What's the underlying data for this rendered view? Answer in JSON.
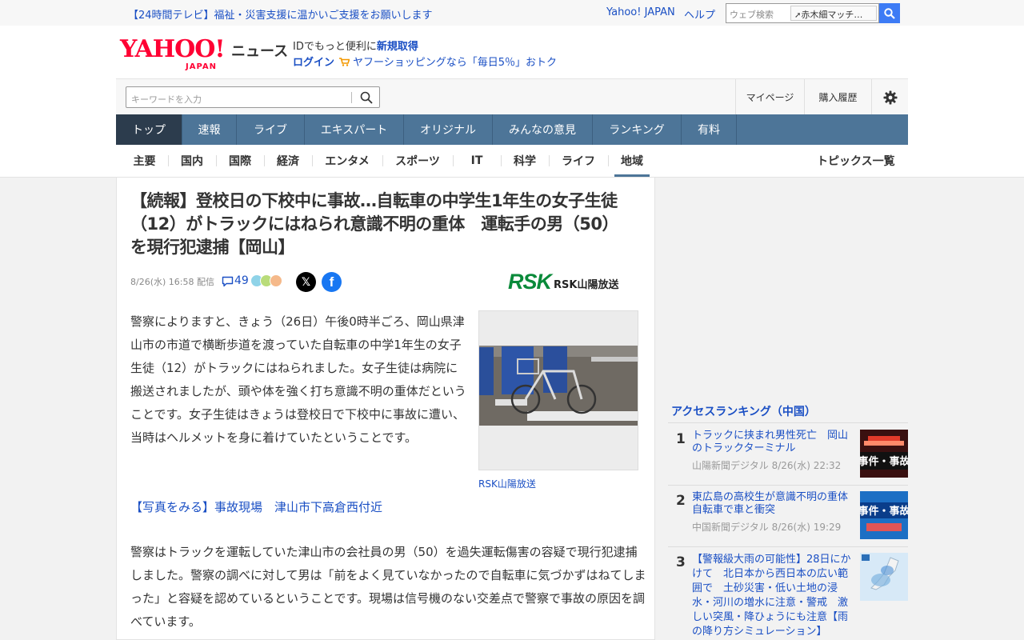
{
  "topbar": {
    "promo": "【24時間テレビ】福祉・災害支援に温かいご支援をお願いします",
    "yahoo_japan": "Yahoo! JAPAN",
    "help": "ヘルプ",
    "web_search_placeholder": "ウェブ検索",
    "search_assist": "赤木細マッチ…"
  },
  "header": {
    "logo_text": "YAHOO!",
    "logo_sub": "JAPAN",
    "service_name": "ニュース",
    "id_prefix": "IDでもっと便利に",
    "register": "新規取得",
    "login": "ログイン",
    "shopping_promo": "ヤフーショッピングなら「毎日5％」おトク"
  },
  "search": {
    "placeholder": "キーワードを入力",
    "mypage": "マイページ",
    "purchase_history": "購入履歴"
  },
  "main_nav": [
    "トップ",
    "速報",
    "ライブ",
    "エキスパート",
    "オリジナル",
    "みんなの意見",
    "ランキング",
    "有料"
  ],
  "sub_nav": [
    "主要",
    "国内",
    "国際",
    "経済",
    "エンタメ",
    "スポーツ",
    "IT",
    "科学",
    "ライフ",
    "地域"
  ],
  "topics_link": "トピックス一覧",
  "article": {
    "headline": "【続報】登校日の下校中に事故…自転車の中学生1年生の女子生徒（12）がトラックにはねられ意識不明の重体　運転手の男（50）を現行犯逮捕【岡山】",
    "meta": "8/26(水) 16:58 配信",
    "comment_count": "49",
    "source_logo": "RSK",
    "source_name": "RSK山陽放送",
    "body1": "警察によりますと、きょう（26日）午後0時半ごろ、岡山県津山市の市道で横断歩道を渡っていた自転車の中学1年生の女子生徒（12）がトラックにはねられました。女子生徒は病院に搬送されましたが、頭や体を強く打ち意識不明の重体だということです。女子生徒はきょうは登校日で下校中に事故に遭い、当時はヘルメットを身に着けていたということです。",
    "photo_caption": "RSK山陽放送",
    "photo_link": "【写真をみる】事故現場　津山市下高倉西付近",
    "body2": "警察はトラックを運転していた津山市の会社員の男（50）を過失運転傷害の容疑で現行犯逮捕しました。警察の調べに対して男は「前をよく見ていなかったので自転車に気づかずはねてしまった」と容疑を認めているということです。現場は信号機のない交差点で警察で事故の原因を調べています。"
  },
  "ranking": {
    "title": "アクセスランキング（中国）",
    "items": [
      {
        "rank": "1",
        "title": "トラックに挟まれ男性死亡　岡山のトラックターミナル",
        "source": "山陽新聞デジタル 8/26(水) 22:32",
        "thumb_label": "事件・事故"
      },
      {
        "rank": "2",
        "title": "東広島の高校生が意識不明の重体　自転車で車と衝突",
        "source": "中国新聞デジタル 8/26(水) 19:29",
        "thumb_label": "事件・事故"
      },
      {
        "rank": "3",
        "title": "【警報級大雨の可能性】28日にかけて　北日本から西日本の広い範囲で　土砂災害・低い土地の浸水・河川の増水に注意・警戒　激しい突風・降ひょうにも注意【雨の降り方シミュレーション】",
        "source": "",
        "thumb_label": ""
      }
    ]
  }
}
